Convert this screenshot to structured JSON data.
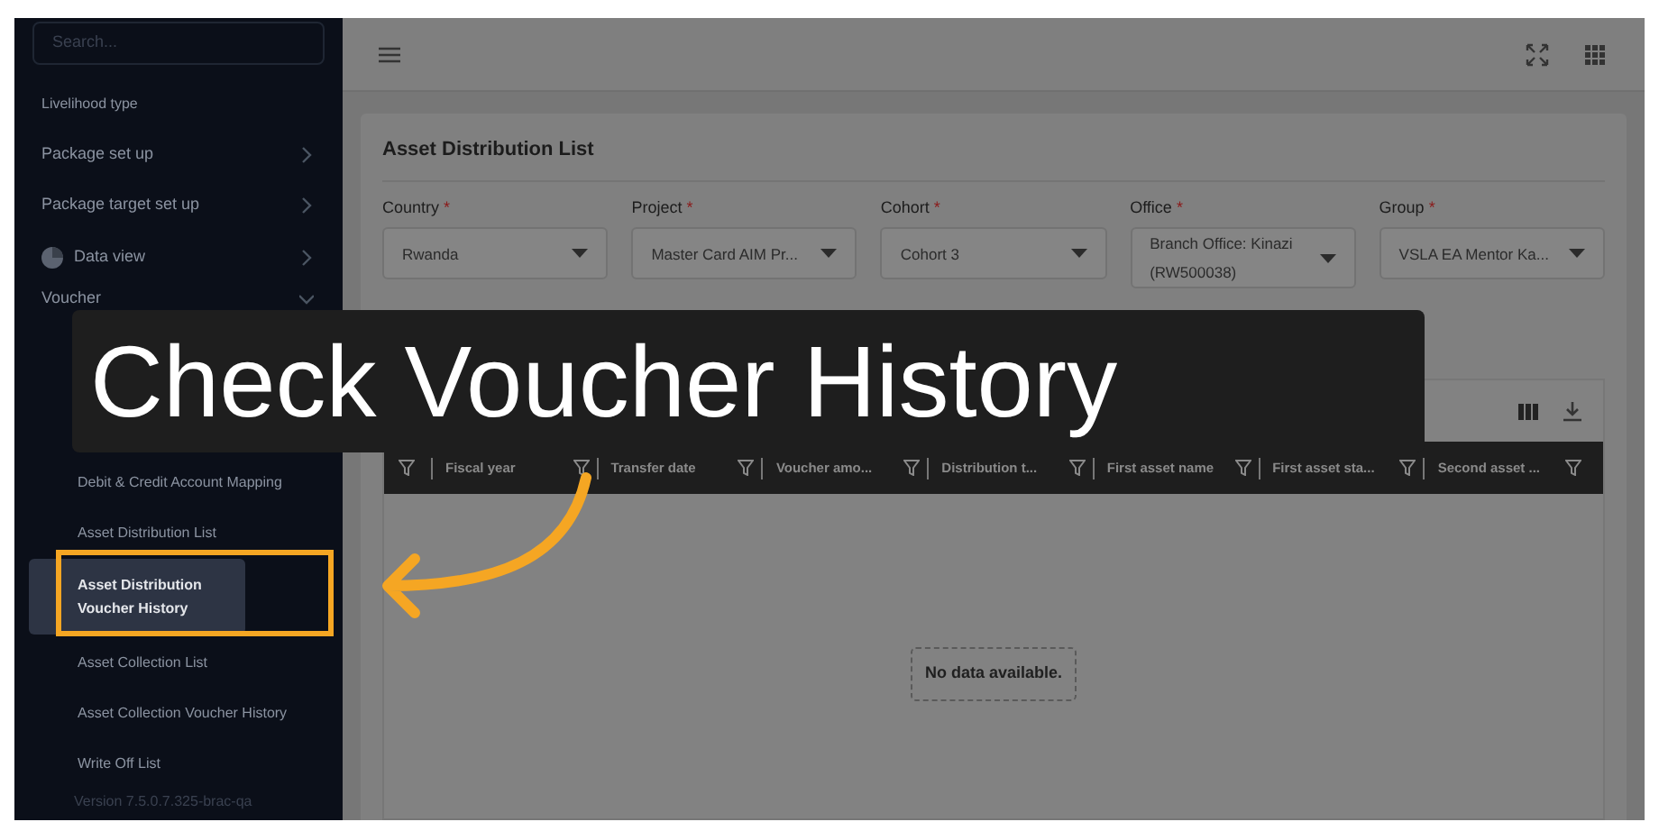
{
  "sidebar": {
    "search_placeholder": "Search...",
    "items": [
      {
        "label": "Livelihood type",
        "kind": "plain"
      },
      {
        "label": "Package set up",
        "kind": "group"
      },
      {
        "label": "Package target set up",
        "kind": "group"
      },
      {
        "label": "Data view",
        "kind": "chart"
      },
      {
        "label": "Voucher",
        "kind": "section",
        "expanded": true,
        "children": [
          {
            "label": "Debit & Credit Account Mapping",
            "selected": false
          },
          {
            "label": "Asset Distribution List",
            "selected": false
          },
          {
            "label": "Asset Distribution Voucher History",
            "selected": true
          },
          {
            "label": "Asset Collection List",
            "selected": false
          },
          {
            "label": "Asset Collection Voucher History",
            "selected": false
          },
          {
            "label": "Write Off List",
            "selected": false
          }
        ]
      }
    ],
    "version": "Version 7.5.0.7.325-brac-qa"
  },
  "page_title": "Asset Distribution List",
  "filters": [
    {
      "label": "Country",
      "required_mark": "*",
      "value": "Rwanda"
    },
    {
      "label": "Project",
      "required_mark": "*",
      "value": "Master Card AIM Pr..."
    },
    {
      "label": "Cohort",
      "required_mark": "*",
      "value": "Cohort 3"
    },
    {
      "label": "Office",
      "required_mark": "*",
      "value": "Branch Office: Kinazi (RW500038)"
    },
    {
      "label": "Group",
      "required_mark": "*",
      "value": "VSLA EA Mentor Ka..."
    }
  ],
  "table": {
    "columns": [
      "Fiscal year",
      "Transfer date",
      "Voucher amo...",
      "Distribution t...",
      "First asset name",
      "First asset sta...",
      "Second asset ..."
    ],
    "empty_message": "No data available."
  },
  "caption": "Check Voucher History"
}
